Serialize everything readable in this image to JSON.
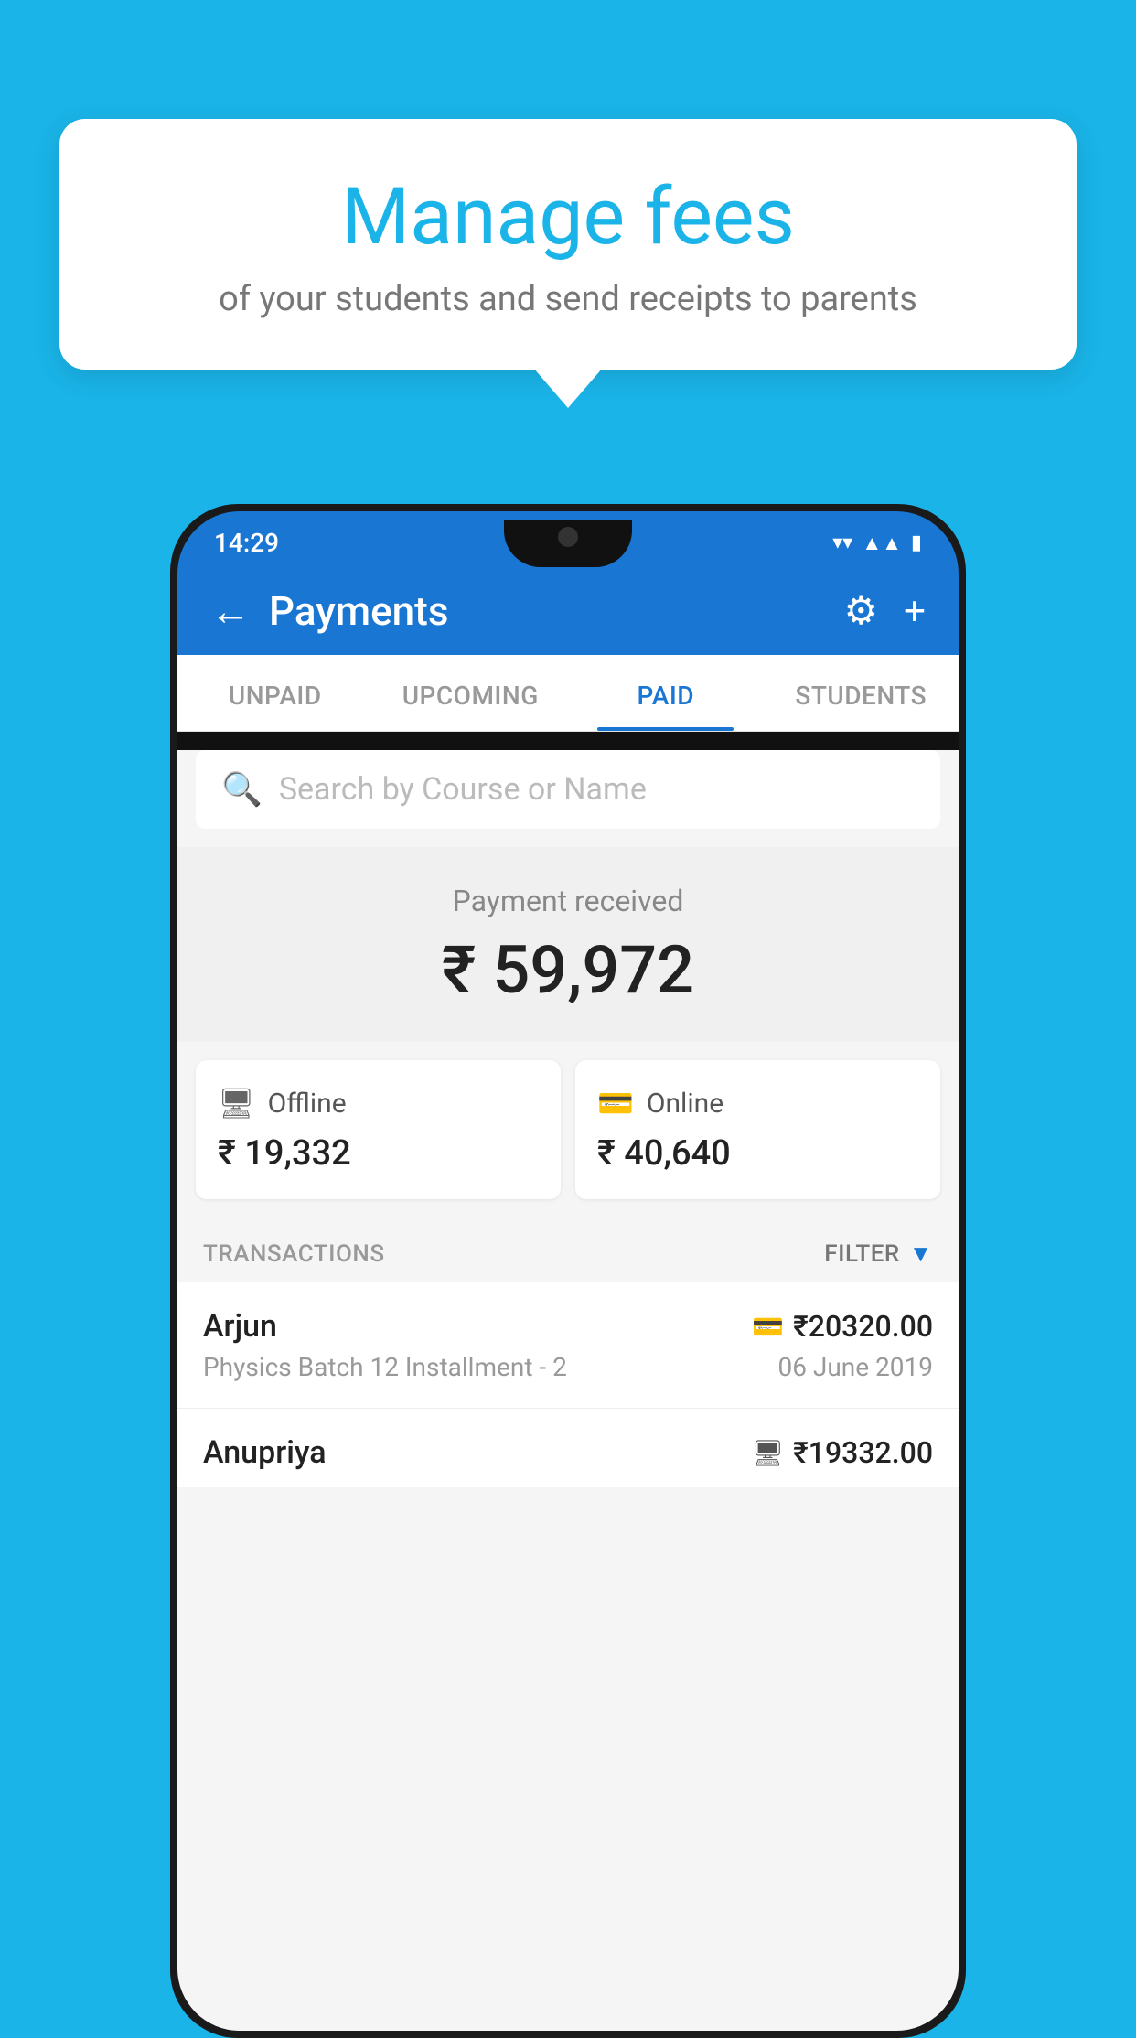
{
  "background_color": "#1ab4e8",
  "bubble": {
    "title": "Manage fees",
    "subtitle": "of your students and send receipts to parents"
  },
  "status_bar": {
    "time": "14:29",
    "wifi_icon": "▼",
    "signal_icon": "▲▲",
    "battery_icon": "▮"
  },
  "top_bar": {
    "back_label": "←",
    "title": "Payments",
    "settings_label": "⚙",
    "add_label": "+"
  },
  "tabs": [
    {
      "label": "UNPAID",
      "active": false
    },
    {
      "label": "UPCOMING",
      "active": false
    },
    {
      "label": "PAID",
      "active": true
    },
    {
      "label": "STUDENTS",
      "active": false
    }
  ],
  "search": {
    "placeholder": "Search by Course or Name",
    "icon": "🔍"
  },
  "payment_summary": {
    "label": "Payment received",
    "amount": "₹ 59,972"
  },
  "payment_cards": [
    {
      "type": "Offline",
      "icon": "🖥",
      "amount": "₹ 19,332"
    },
    {
      "type": "Online",
      "icon": "💳",
      "amount": "₹ 40,640"
    }
  ],
  "transactions_section": {
    "label": "TRANSACTIONS",
    "filter_label": "FILTER"
  },
  "transactions": [
    {
      "name": "Arjun",
      "payment_icon": "💳",
      "amount": "₹20320.00",
      "course": "Physics Batch 12 Installment - 2",
      "date": "06 June 2019"
    },
    {
      "name": "Anupriya",
      "payment_icon": "🖥",
      "amount": "₹19332.00",
      "course": "",
      "date": ""
    }
  ],
  "colors": {
    "primary": "#1976d2",
    "accent": "#1ab4e8",
    "text_dark": "#222222",
    "text_medium": "#555555",
    "text_light": "#999999"
  }
}
